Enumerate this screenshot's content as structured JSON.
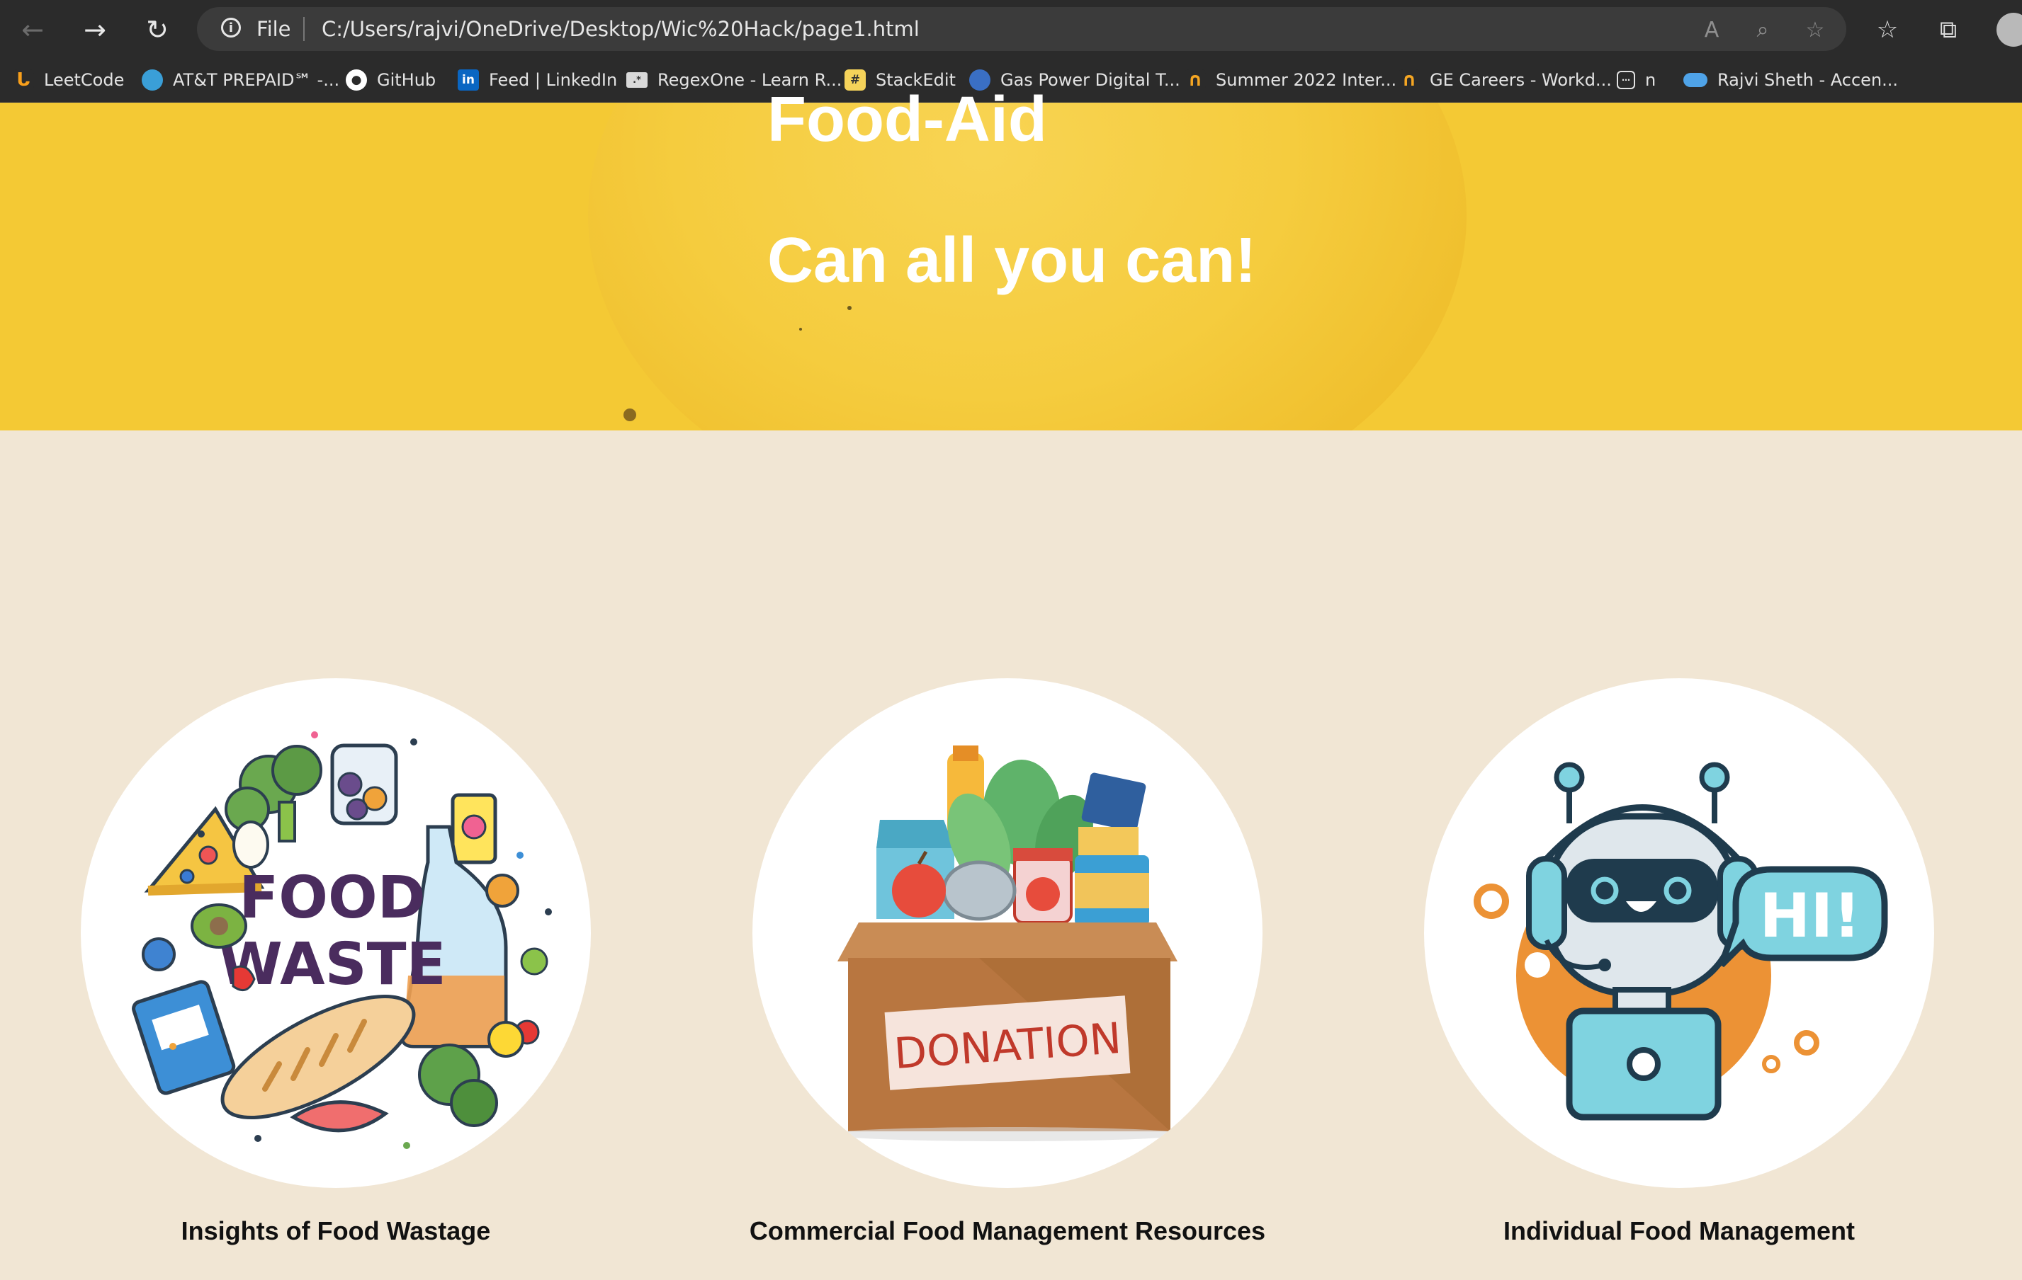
{
  "browser": {
    "scheme_label": "File",
    "url": "C:/Users/rajvi/OneDrive/Desktop/Wic%20Hack/page1.html"
  },
  "bookmarks": [
    {
      "label": "LeetCode",
      "icon": "leetcode-icon",
      "color": "#f89f1b"
    },
    {
      "label": "AT&T PREPAID℠ -...",
      "icon": "att-globe-icon",
      "color": "#3a9fd8"
    },
    {
      "label": "GitHub",
      "icon": "github-icon",
      "color": "#ffffff"
    },
    {
      "label": "Feed | LinkedIn",
      "icon": "linkedin-icon",
      "color": "#0a66c2"
    },
    {
      "label": "RegexOne - Learn R...",
      "icon": "regexone-icon",
      "color": "#d9d9d9"
    },
    {
      "label": "StackEdit",
      "icon": "stackedit-icon",
      "color": "#f5d35a"
    },
    {
      "label": "Gas Power Digital T...",
      "icon": "ge-icon",
      "color": "#3a6fc4"
    },
    {
      "label": "Summer 2022 Inter...",
      "icon": "workday-icon",
      "color": "#f5a623"
    },
    {
      "label": "GE Careers - Workd...",
      "icon": "workday-icon",
      "color": "#f5a623"
    },
    {
      "label": "n",
      "icon": "calendar-icon",
      "color": "#e3e3e3"
    },
    {
      "label": "Rajvi Sheth - Accen...",
      "icon": "salesforce-cloud-icon",
      "color": "#4fa3e8"
    }
  ],
  "hero": {
    "title": "Food-Aid",
    "tagline": "Can all you can!",
    "background_color": "#f4c934"
  },
  "page": {
    "background_color": "#f1e6d4"
  },
  "cards": [
    {
      "label": "Insights of Food Wastage",
      "image_text_line1": "FOOD",
      "image_text_line2": "WASTE"
    },
    {
      "label": "Commercial Food Management Resources",
      "image_text": "DONATION"
    },
    {
      "label": "Individual Food Management",
      "image_text": "HI!"
    }
  ]
}
